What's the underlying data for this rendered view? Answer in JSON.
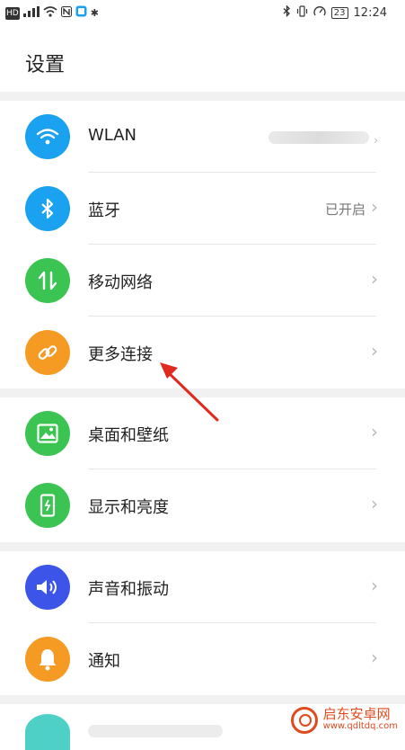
{
  "status_bar": {
    "left_icons": [
      "HD",
      "4G signal",
      "wifi",
      "NFC",
      "app",
      "gear"
    ],
    "right_icons": [
      "bluetooth",
      "vibrate",
      "speed"
    ],
    "battery": "23",
    "time": "12:24"
  },
  "page": {
    "title": "设置"
  },
  "rows": [
    {
      "label": "WLAN",
      "value": "",
      "icon": "wifi-icon",
      "color": "#1aa1f0"
    },
    {
      "label": "蓝牙",
      "value": "已开启",
      "icon": "bluetooth-icon",
      "color": "#1aa1f0"
    },
    {
      "label": "移动网络",
      "value": "",
      "icon": "mobile-data-icon",
      "color": "#3cc453"
    },
    {
      "label": "更多连接",
      "value": "",
      "icon": "link-icon",
      "color": "#f59a22"
    },
    {
      "label": "桌面和壁纸",
      "value": "",
      "icon": "wallpaper-icon",
      "color": "#3cc453"
    },
    {
      "label": "显示和亮度",
      "value": "",
      "icon": "display-icon",
      "color": "#3cc453"
    },
    {
      "label": "声音和振动",
      "value": "",
      "icon": "sound-icon",
      "color": "#3c55e8"
    },
    {
      "label": "通知",
      "value": "",
      "icon": "bell-icon",
      "color": "#f59a22"
    }
  ],
  "watermark": {
    "title": "启东安卓网",
    "subtitle": "www.qdltdq.com"
  },
  "colors": {
    "annotation_arrow": "#e0291f",
    "chevron": "#b8b8b8",
    "group_gap": "#f1f1f1"
  }
}
